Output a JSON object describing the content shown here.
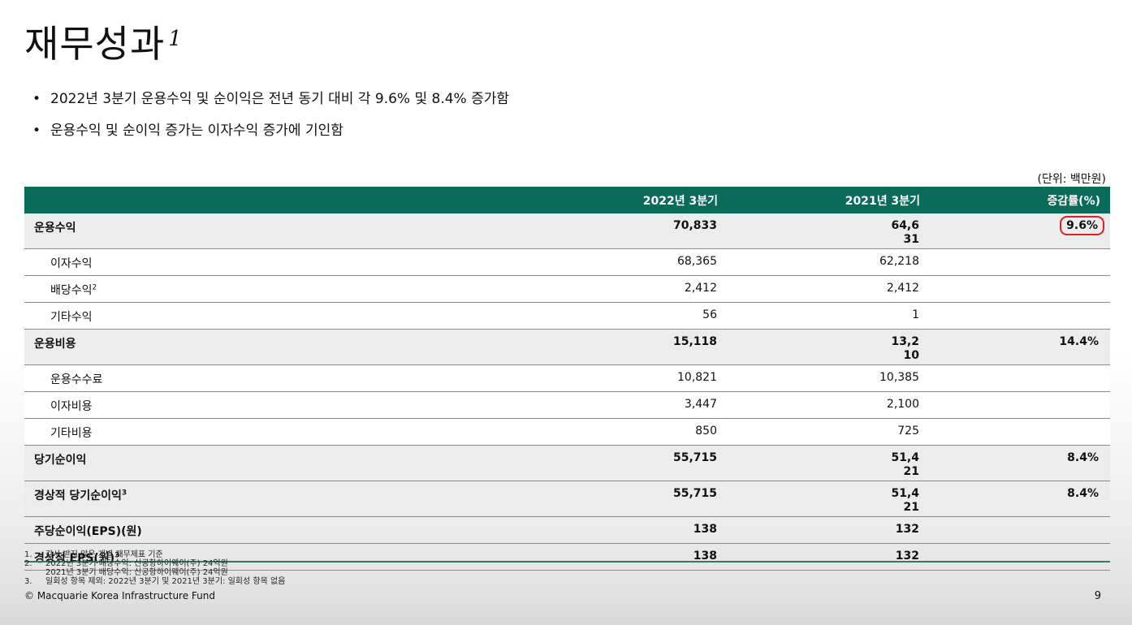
{
  "title": "재무성과",
  "title_note": "1",
  "bullets": [
    "2022년 3분기 운용수익 및 순이익은 전년 동기 대비 각 9.6% 및 8.4% 증가함",
    "운용수익 및 순이익 증가는 이자수익 증가에 기인함"
  ],
  "unit": "(단위: 백만원)",
  "table": {
    "headers": [
      "",
      "2022년 3분기",
      "2021년 3분기",
      "증감률(%)"
    ],
    "rows": [
      {
        "label": "운용수익",
        "sup": "",
        "v2022": "70,833",
        "v2021": "64,631",
        "pct": "9.6%"
      },
      {
        "label": "이자수익",
        "sup": "",
        "v2022": "68,365",
        "v2021": "62,218",
        "pct": ""
      },
      {
        "label": "배당수익",
        "sup": "2",
        "v2022": "2,412",
        "v2021": "2,412",
        "pct": ""
      },
      {
        "label": "기타수익",
        "sup": "",
        "v2022": "56",
        "v2021": "1",
        "pct": ""
      },
      {
        "label": "운용비용",
        "sup": "",
        "v2022": "15,118",
        "v2021": "13,210",
        "pct": "14.4%"
      },
      {
        "label": "운용수수료",
        "sup": "",
        "v2022": "10,821",
        "v2021": "10,385",
        "pct": ""
      },
      {
        "label": "이자비용",
        "sup": "",
        "v2022": "3,447",
        "v2021": "2,100",
        "pct": ""
      },
      {
        "label": "기타비용",
        "sup": "",
        "v2022": "850",
        "v2021": "725",
        "pct": ""
      },
      {
        "label": "당기순이익",
        "sup": "",
        "v2022": "55,715",
        "v2021": "51,421",
        "pct": "8.4%"
      },
      {
        "label": "경상적 당기순이익",
        "sup": "3",
        "v2022": "55,715",
        "v2021": "51,421",
        "pct": "8.4%"
      },
      {
        "label": "주당순이익(EPS)(원)",
        "sup": "",
        "v2022": "138",
        "v2021": "132",
        "pct": ""
      },
      {
        "label": "경상적 EPS(원)",
        "sup": "3",
        "v2022": "138",
        "v2021": "132",
        "pct": ""
      }
    ]
  },
  "footnotes": [
    {
      "n": "1.",
      "text": "감사 받지 않은 개별 재무제표 기준"
    },
    {
      "n": "2.",
      "text": "2022년 3분기 배당수익: 신공항하이웨이(주) 24억원"
    },
    {
      "n": "",
      "text": "2021년 3분기 배당수익: 신공항하이웨이(주) 24억원"
    },
    {
      "n": "3.",
      "text": "일회성 항목 제외: 2022년 3분기 및 2021년 3분기: 일회성 항목 없음"
    }
  ],
  "copyright": "© Macquarie Korea Infrastructure Fund",
  "page_number": "9",
  "colors": {
    "header_bg": "#0b6b59",
    "highlight_circle": "#e02020"
  }
}
